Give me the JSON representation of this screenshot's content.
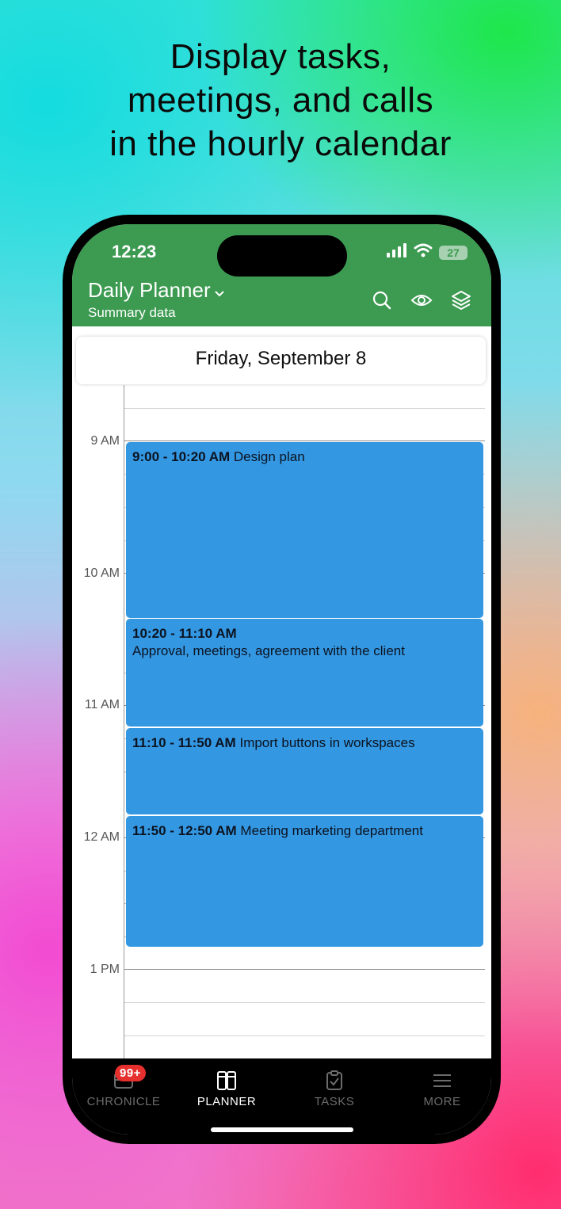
{
  "headline": {
    "line1": "Display tasks,",
    "line2": "meetings, and calls",
    "line3": "in the hourly calendar"
  },
  "status_bar": {
    "time": "12:23",
    "battery": "27",
    "icons": [
      "cellular-signal-icon",
      "wifi-icon",
      "battery-icon"
    ]
  },
  "app_bar": {
    "title": "Daily Planner",
    "subtitle": "Summary data",
    "icons": [
      "search-icon",
      "eye-icon",
      "layers-icon"
    ],
    "color": "#3c9a51"
  },
  "calendar": {
    "day_title": "Friday, September 8",
    "hour_labels": [
      "9 AM",
      "10 AM",
      "11 AM",
      "12 AM",
      "1 PM"
    ],
    "events": [
      {
        "time": "9:00 - 10:20 AM",
        "title": "Design plan"
      },
      {
        "time": "10:20 - 11:10 AM",
        "title": "Approval, meetings, agreement with the client"
      },
      {
        "time": "11:10 - 11:50 AM",
        "title": "Import buttons in workspaces"
      },
      {
        "time": "11:50 - 12:50 AM",
        "title": "Meeting marketing department"
      }
    ],
    "event_color": "#3397e2"
  },
  "tab_bar": {
    "tabs": [
      {
        "label": "CHRONICLE",
        "icon": "chronicle-icon",
        "badge": "99+"
      },
      {
        "label": "PLANNER",
        "icon": "planner-icon",
        "active": true
      },
      {
        "label": "TASKS",
        "icon": "tasks-clipboard-icon"
      },
      {
        "label": "MORE",
        "icon": "menu-lines-icon"
      }
    ]
  }
}
